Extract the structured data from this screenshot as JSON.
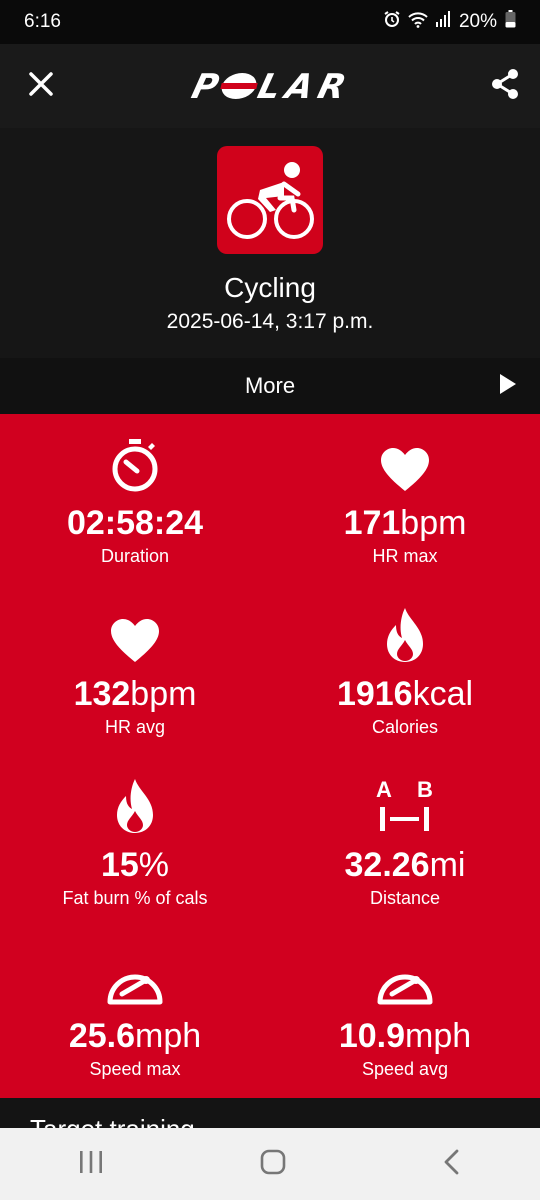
{
  "status": {
    "time": "6:16",
    "battery": "20%"
  },
  "app": {
    "logo": "POLAR"
  },
  "session": {
    "sport": "Cycling",
    "date": "2025-06-14, 3:17 p.m.",
    "sport_icon": "cycling-icon"
  },
  "more": {
    "label": "More"
  },
  "stats": [
    {
      "icon": "stopwatch-icon",
      "value": "02:58:24",
      "unit": "",
      "label": "Duration"
    },
    {
      "icon": "heart-icon",
      "value": "171",
      "unit": "bpm",
      "label": "HR max"
    },
    {
      "icon": "heart-icon",
      "value": "132",
      "unit": "bpm",
      "label": "HR avg"
    },
    {
      "icon": "flame-icon",
      "value": "1916",
      "unit": "kcal",
      "label": "Calories"
    },
    {
      "icon": "flame-icon",
      "value": "15",
      "unit": "%",
      "label": "Fat burn % of cals"
    },
    {
      "icon": "distance-ab-icon",
      "value": "32.26",
      "unit": "mi",
      "label": "Distance"
    },
    {
      "icon": "speedometer-icon",
      "value": "25.6",
      "unit": "mph",
      "label": "Speed max"
    },
    {
      "icon": "speedometer-icon",
      "value": "10.9",
      "unit": "mph",
      "label": "Speed avg"
    }
  ],
  "next_section": {
    "title": "Target training"
  },
  "colors": {
    "brand_red": "#d1001f",
    "dark_bg": "#161616"
  }
}
